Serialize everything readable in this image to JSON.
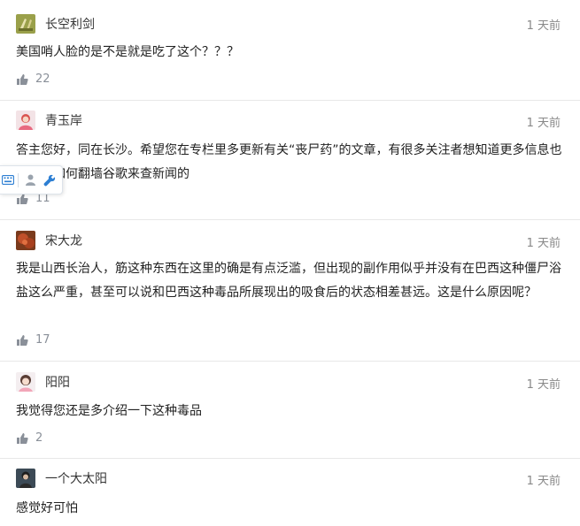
{
  "comments": [
    {
      "user": "长空利剑",
      "time": "1 天前",
      "text": "美国哨人脸的是不是就是吃了这个？？？",
      "likes": "22"
    },
    {
      "user": "青玉岸",
      "time": "1 天前",
      "text": "答主您好，同在长沙。希望您在专栏里多更新有关“丧尸药”的文章，有很多关注者想知道更多信息也不懂的如何翻墙谷歌来查新闻的",
      "likes": "11"
    },
    {
      "user": "宋大龙",
      "time": "1 天前",
      "text": "我是山西长治人，筋这种东西在这里的确是有点泛滥，但出现的副作用似乎并没有在巴西这种僵尸浴盐这么严重，甚至可以说和巴西这种毒品所展现出的吸食后的状态相差甚远。这是什么原因呢？",
      "likes": "17"
    },
    {
      "user": "阳阳",
      "time": "1 天前",
      "text": "我觉得您还是多介绍一下这种毒品",
      "likes": "2"
    },
    {
      "user": "一个大太阳",
      "time": "1 天前",
      "text": "感觉好可怕",
      "likes": ""
    }
  ],
  "icons": {
    "like": "thumbs-up-icon",
    "keyboard": "keyboard-icon",
    "person": "person-icon",
    "wrench": "wrench-icon"
  },
  "colors": {
    "text": "#222222",
    "meta": "#888888",
    "like": "#8a9099",
    "divider": "#e8e8e8",
    "toolbar_icon": "#2d7fd3"
  }
}
